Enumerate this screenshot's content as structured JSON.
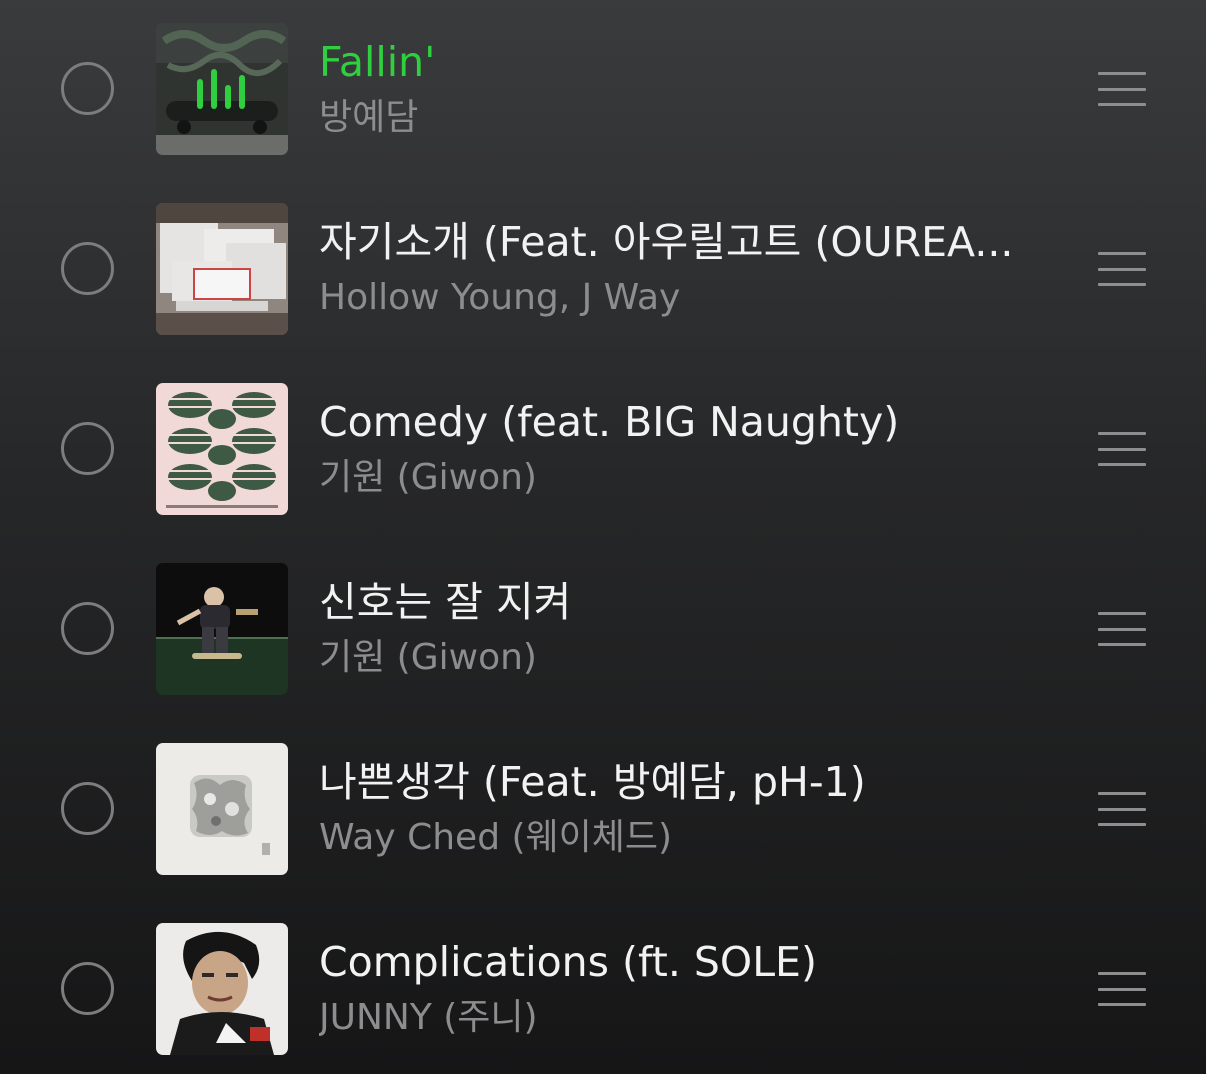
{
  "tracks": [
    {
      "title": "Fallin'",
      "artist": "방예담",
      "now_playing": true,
      "art": "album-art-graffiti-skate"
    },
    {
      "title": "자기소개 (Feat. 아우릴고트 (OUREA...",
      "artist": "Hollow Young, J Way",
      "now_playing": false,
      "art": "album-art-dialog-windows"
    },
    {
      "title": "Comedy (feat. BIG Naughty)",
      "artist": "기원 (Giwon)",
      "now_playing": false,
      "art": "album-art-clover-stripes"
    },
    {
      "title": "신호는 잘 지켜",
      "artist": "기원 (Giwon)",
      "now_playing": false,
      "art": "album-art-skater-night"
    },
    {
      "title": "나쁜생각 (Feat. 방예담, pH-1)",
      "artist": "Way Ched (웨이체드)",
      "now_playing": false,
      "art": "album-art-silver-sculpture"
    },
    {
      "title": "Complications (ft. SOLE)",
      "artist": "JUNNY (주니)",
      "now_playing": false,
      "art": "album-art-portrait"
    }
  ],
  "colors": {
    "accent_green": "#2fcf3f",
    "title_text": "#f2f2f2",
    "artist_text": "#8d8d90"
  }
}
